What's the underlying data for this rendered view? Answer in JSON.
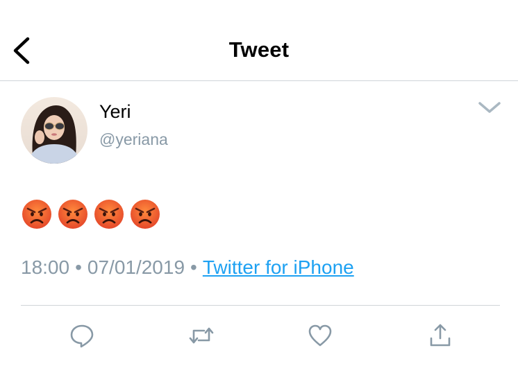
{
  "header": {
    "title": "Tweet",
    "back_icon": "chevron-left-icon"
  },
  "author": {
    "display_name": "Yeri",
    "handle": "@yeriana",
    "avatar": "profile-photo",
    "menu_icon": "chevron-down-icon"
  },
  "tweet": {
    "emoji": [
      "😡",
      "😡",
      "😡",
      "😡"
    ],
    "emoji_icon": "angry-face-emoji"
  },
  "meta": {
    "time": "18:00",
    "separator": "•",
    "date": "07/01/2019",
    "source": "Twitter for iPhone"
  },
  "actions": [
    {
      "name": "reply",
      "icon": "reply-icon"
    },
    {
      "name": "retweet",
      "icon": "retweet-icon"
    },
    {
      "name": "like",
      "icon": "heart-icon"
    },
    {
      "name": "share",
      "icon": "share-icon"
    }
  ],
  "colors": {
    "accent": "#1da1f2",
    "secondary_text": "#8899a6",
    "icon": "#8899a6",
    "divider": "#cfd4d8"
  }
}
